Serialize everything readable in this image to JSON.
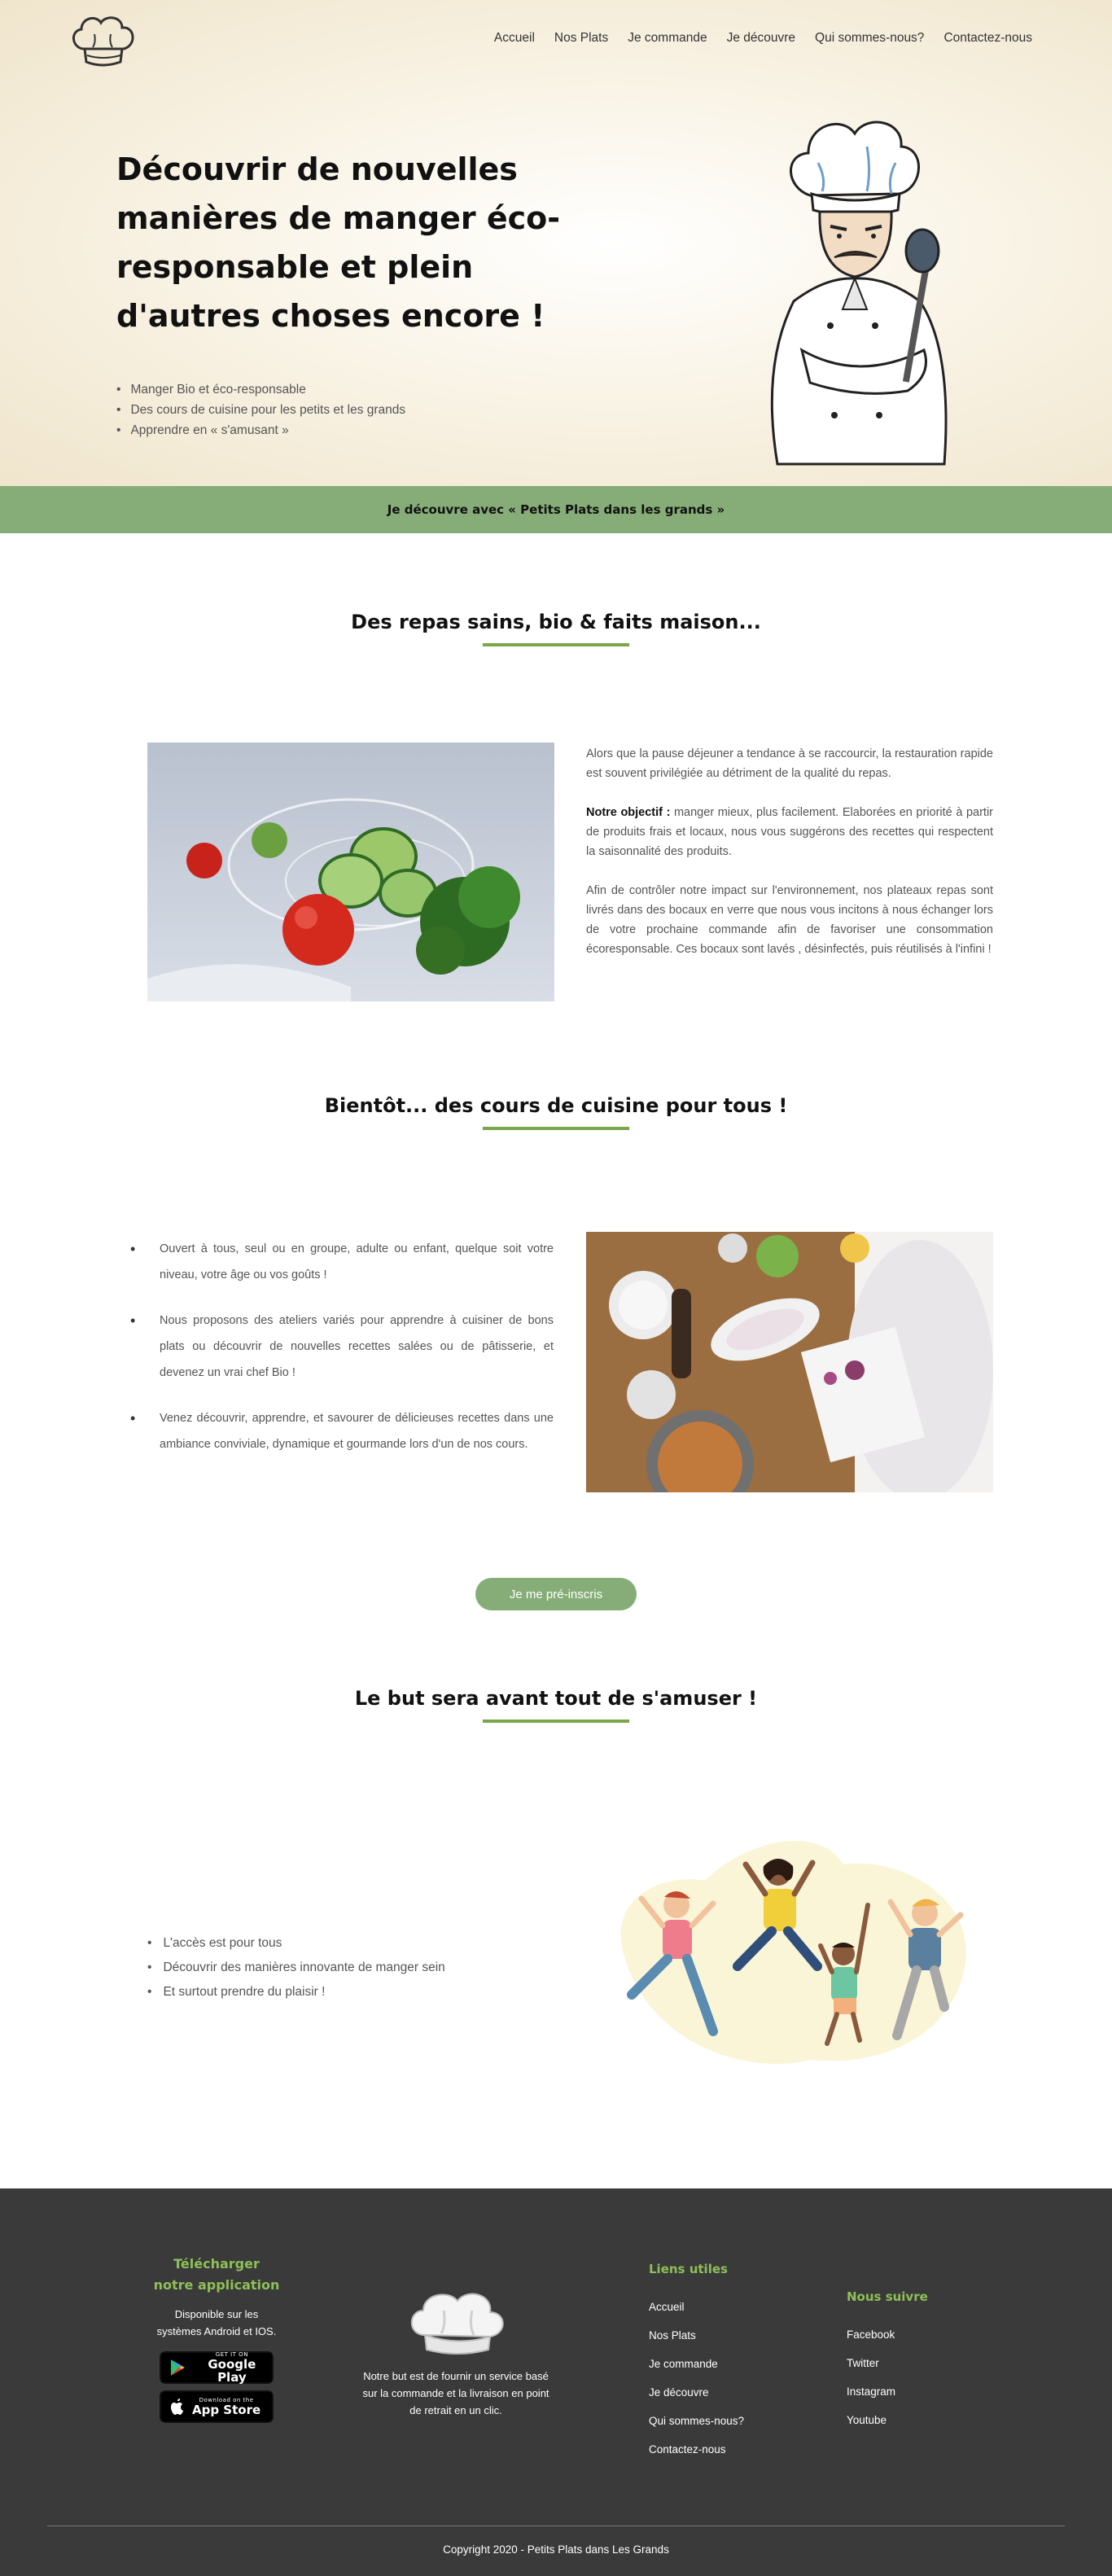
{
  "nav": {
    "items": [
      "Accueil",
      "Nos Plats",
      "Je commande",
      "Je découvre",
      "Qui sommes-nous?",
      "Contactez-nous"
    ]
  },
  "hero": {
    "title": "Découvrir de nouvelles manières de manger éco-responsable et plein d'autres choses encore !",
    "bullets": [
      "Manger Bio et éco-responsable",
      "Des cours de cuisine pour les petits et les grands",
      "Apprendre en « s'amusant »"
    ]
  },
  "band": {
    "label": "Je découvre avec « Petits Plats dans les grands »"
  },
  "section1": {
    "title": "Des repas sains, bio & faits maison...",
    "p1": "Alors que la pause déjeuner a tendance à se raccourcir, la restauration rapide est souvent privilégiée au détriment de la qualité du repas.",
    "p2_bold": "Notre objectif :",
    "p2_rest": " manger mieux, plus facilement. Elaborées en priorité à partir de produits frais et locaux, nous vous suggérons des recettes qui respectent la saisonnalité des produits.",
    "p3": "Afin de contrôler notre impact sur l'environnement, nos plateaux repas sont livrés dans des bocaux en verre que nous vous incitons à nous échanger lors de votre prochaine commande afin de favoriser une consommation écoresponsable. Ces bocaux sont lavés , désinfectés, puis réutilisés à l'infini !"
  },
  "section2": {
    "title": "Bientôt... des cours de cuisine pour tous !",
    "bullets": [
      "Ouvert à tous, seul ou en groupe, adulte ou enfant, quelque soit votre niveau, votre âge ou vos goûts !",
      "Nous proposons des ateliers variés pour apprendre à cuisiner de bons plats ou découvrir de nouvelles recettes salées ou de pâtisserie, et devenez un vrai chef Bio !",
      "Venez découvrir, apprendre, et savourer de délicieuses recettes dans une ambiance conviviale, dynamique et gourmande lors d'un de nos cours."
    ],
    "button": "Je me pré-inscris"
  },
  "section3": {
    "title": "Le but sera avant tout de s'amuser !",
    "bullets": [
      "L'accès est pour tous",
      "Découvrir des manières innovante de manger sein",
      "Et surtout prendre du plaisir !"
    ]
  },
  "footer": {
    "app_title": "Télécharger notre application",
    "app_text": "Disponible sur les systèmes Android et IOS.",
    "google_small": "GET IT ON",
    "google_big": "Google Play",
    "apple_small": "Download on the",
    "apple_big": "App Store",
    "about": "Notre but est de fournir un service basé sur la commande et la livraison en point de retrait en un clic.",
    "links_title": "Liens utiles",
    "links": [
      "Accueil",
      "Nos Plats",
      "Je commande",
      "Je découvre",
      "Qui sommes-nous?",
      "Contactez-nous"
    ],
    "follow_title": "Nous suivre",
    "follow": [
      "Facebook",
      "Twitter",
      "Instagram",
      "Youtube"
    ],
    "copyright": "Copyright 2020 - Petits Plats dans Les Grands"
  },
  "colors": {
    "accent_green": "#86ad78",
    "underline_green": "#7aa64a",
    "footer_bg": "#3a3a3a",
    "footer_heading": "#8fbf57"
  }
}
